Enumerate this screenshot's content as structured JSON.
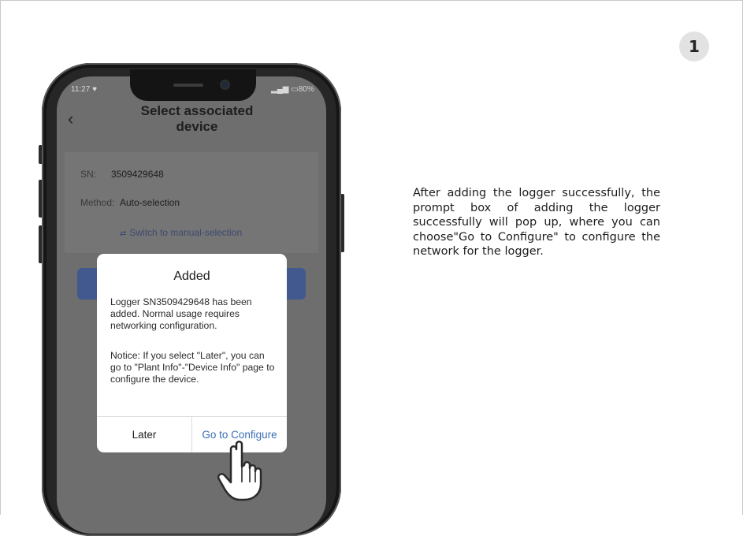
{
  "step_number": "1",
  "description": "After adding the logger successfully, the prompt box of adding the logger successfully will pop up, where you can choose\"Go to Configure\" to configure the network for the logger.",
  "phone": {
    "status": {
      "time": "11:27",
      "battery": "80%"
    },
    "header": {
      "back_icon": "chevron-left-icon",
      "title": "Select associated device"
    },
    "sn_label": "SN:",
    "sn_value": "3509429648",
    "method_label": "Method:",
    "method_value": "Auto-selection",
    "switch_link": "Switch to manual-selection",
    "dialog": {
      "title": "Added",
      "message": "Logger SN3509429648 has been added. Normal usage requires networking configuration.",
      "notice": "Notice: If you select \"Later\", you can go to \"Plant Info\"-\"Device Info\" page to configure the device.",
      "later_label": "Later",
      "configure_label": "Go to Configure"
    }
  },
  "colors": {
    "accent": "#3a6fb5",
    "primary_button": "#41598f",
    "overlay": "#6e6e6e"
  }
}
